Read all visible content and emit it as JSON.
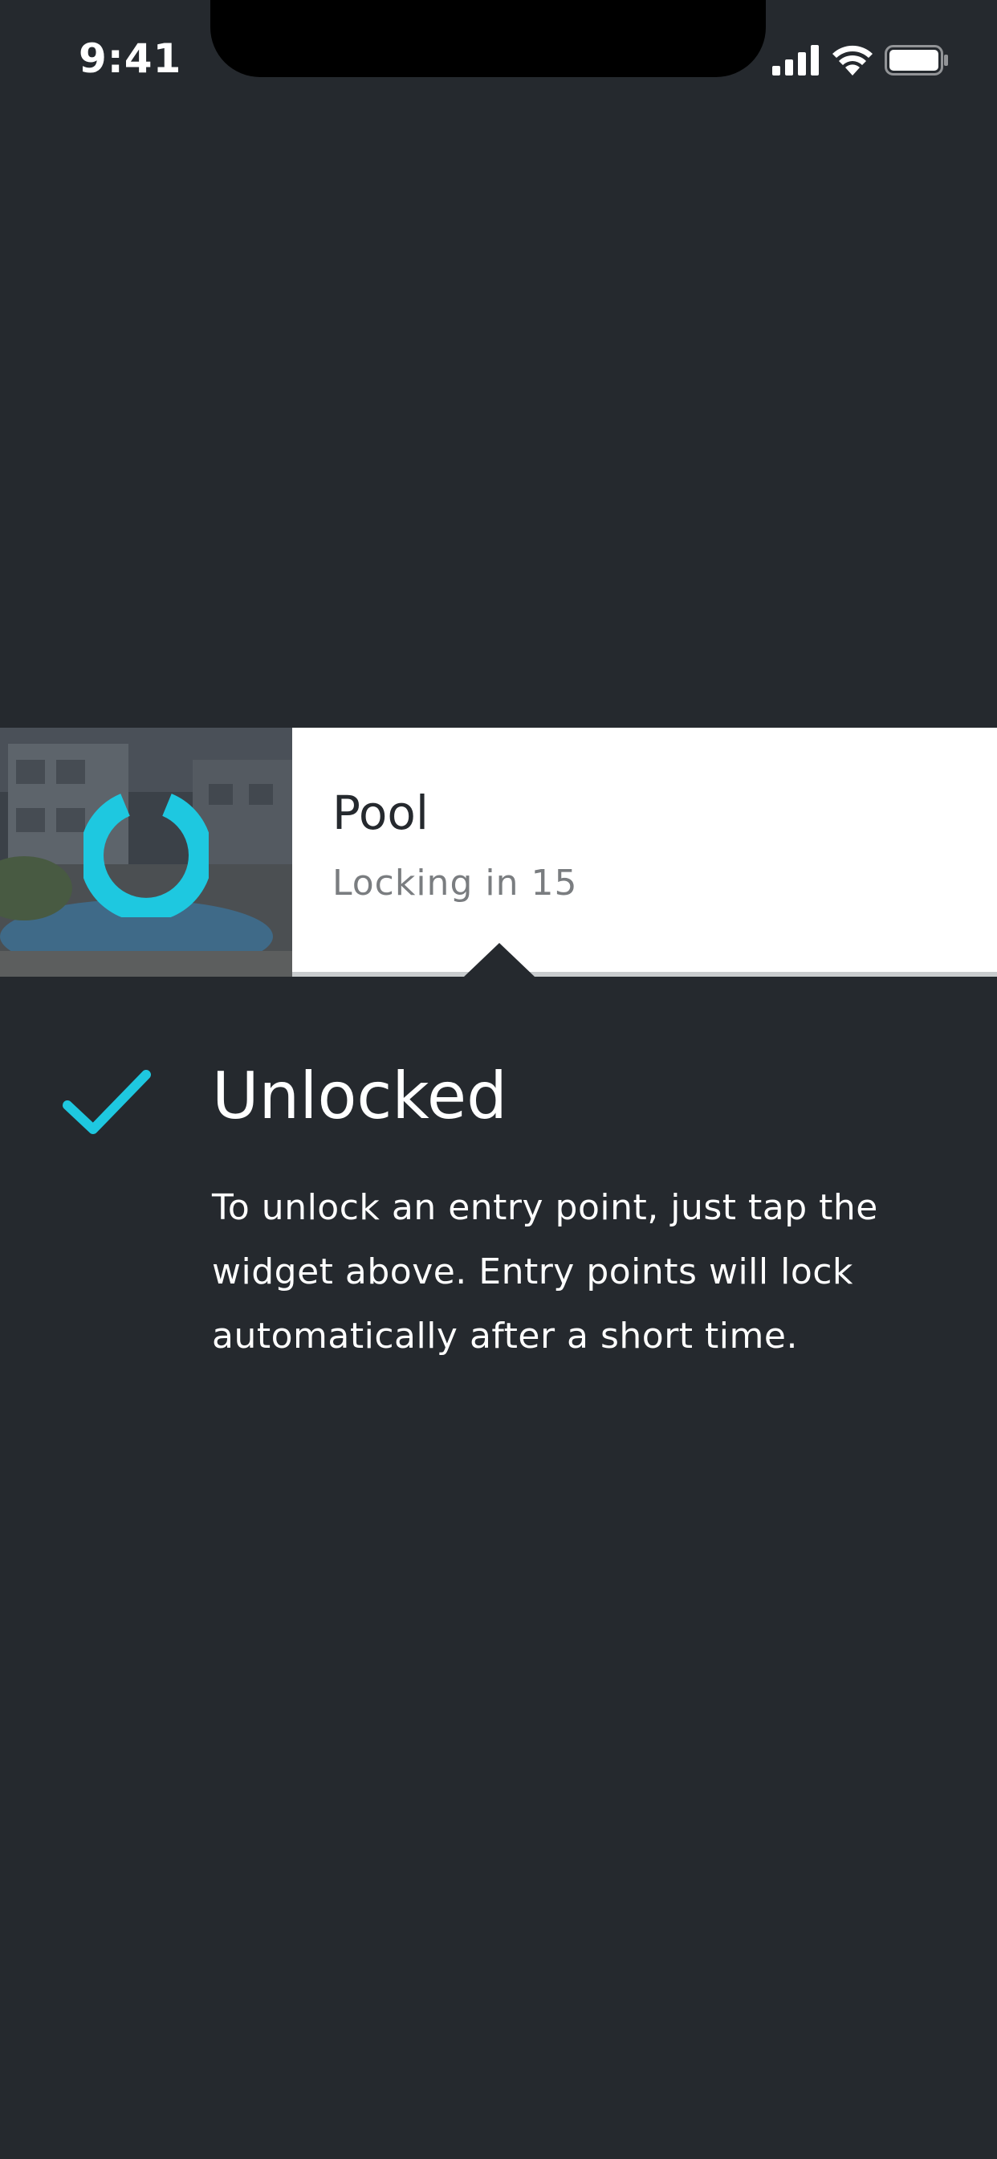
{
  "status_bar": {
    "time": "9:41"
  },
  "widget": {
    "title": "Pool",
    "subtitle": "Locking in 15",
    "thumbnail_icon": "lock-spinner-icon"
  },
  "status": {
    "icon": "checkmark-icon",
    "heading": "Unlocked",
    "message": "To unlock an entry point, just tap the widget above. Entry points will lock automatically after a short time."
  },
  "colors": {
    "background": "#25292e",
    "accent": "#1ec8e0",
    "widget_background": "#ffffff",
    "subtitle": "#7a7d80"
  }
}
